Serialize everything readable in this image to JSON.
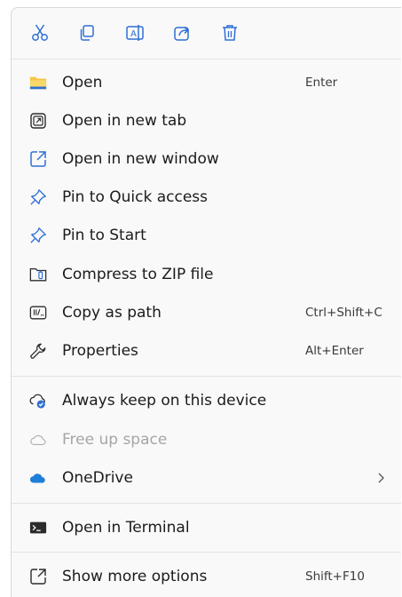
{
  "toolbar": {
    "buttons": [
      {
        "name": "cut-icon"
      },
      {
        "name": "copy-icon"
      },
      {
        "name": "rename-icon"
      },
      {
        "name": "share-icon"
      },
      {
        "name": "delete-icon"
      }
    ]
  },
  "items": [
    {
      "label": "Open",
      "shortcut": "Enter",
      "icon": "folder-icon"
    },
    {
      "label": "Open in new tab",
      "shortcut": "",
      "icon": "new-tab-icon"
    },
    {
      "label": "Open in new window",
      "shortcut": "",
      "icon": "new-window-icon"
    },
    {
      "label": "Pin to Quick access",
      "shortcut": "",
      "icon": "pin-icon"
    },
    {
      "label": "Pin to Start",
      "shortcut": "",
      "icon": "pin-icon"
    },
    {
      "label": "Compress to ZIP file",
      "shortcut": "",
      "icon": "zip-icon"
    },
    {
      "label": "Copy as path",
      "shortcut": "Ctrl+Shift+C",
      "icon": "copy-path-icon"
    },
    {
      "label": "Properties",
      "shortcut": "Alt+Enter",
      "icon": "wrench-icon"
    },
    {
      "label": "Always keep on this device",
      "shortcut": "",
      "icon": "cloud-keep-icon"
    },
    {
      "label": "Free up space",
      "shortcut": "",
      "icon": "cloud-outline-icon",
      "disabled": true
    },
    {
      "label": "OneDrive",
      "shortcut": "",
      "icon": "onedrive-icon",
      "submenu": true
    },
    {
      "label": "Open in Terminal",
      "shortcut": "",
      "icon": "terminal-icon"
    },
    {
      "label": "Show more options",
      "shortcut": "Shift+F10",
      "icon": "more-options-icon"
    }
  ],
  "colors": {
    "accent": "#2f6fd6",
    "folder": "#f6c548",
    "onedrive": "#1f7fd8",
    "disabled_text": "#a5a5a5"
  }
}
